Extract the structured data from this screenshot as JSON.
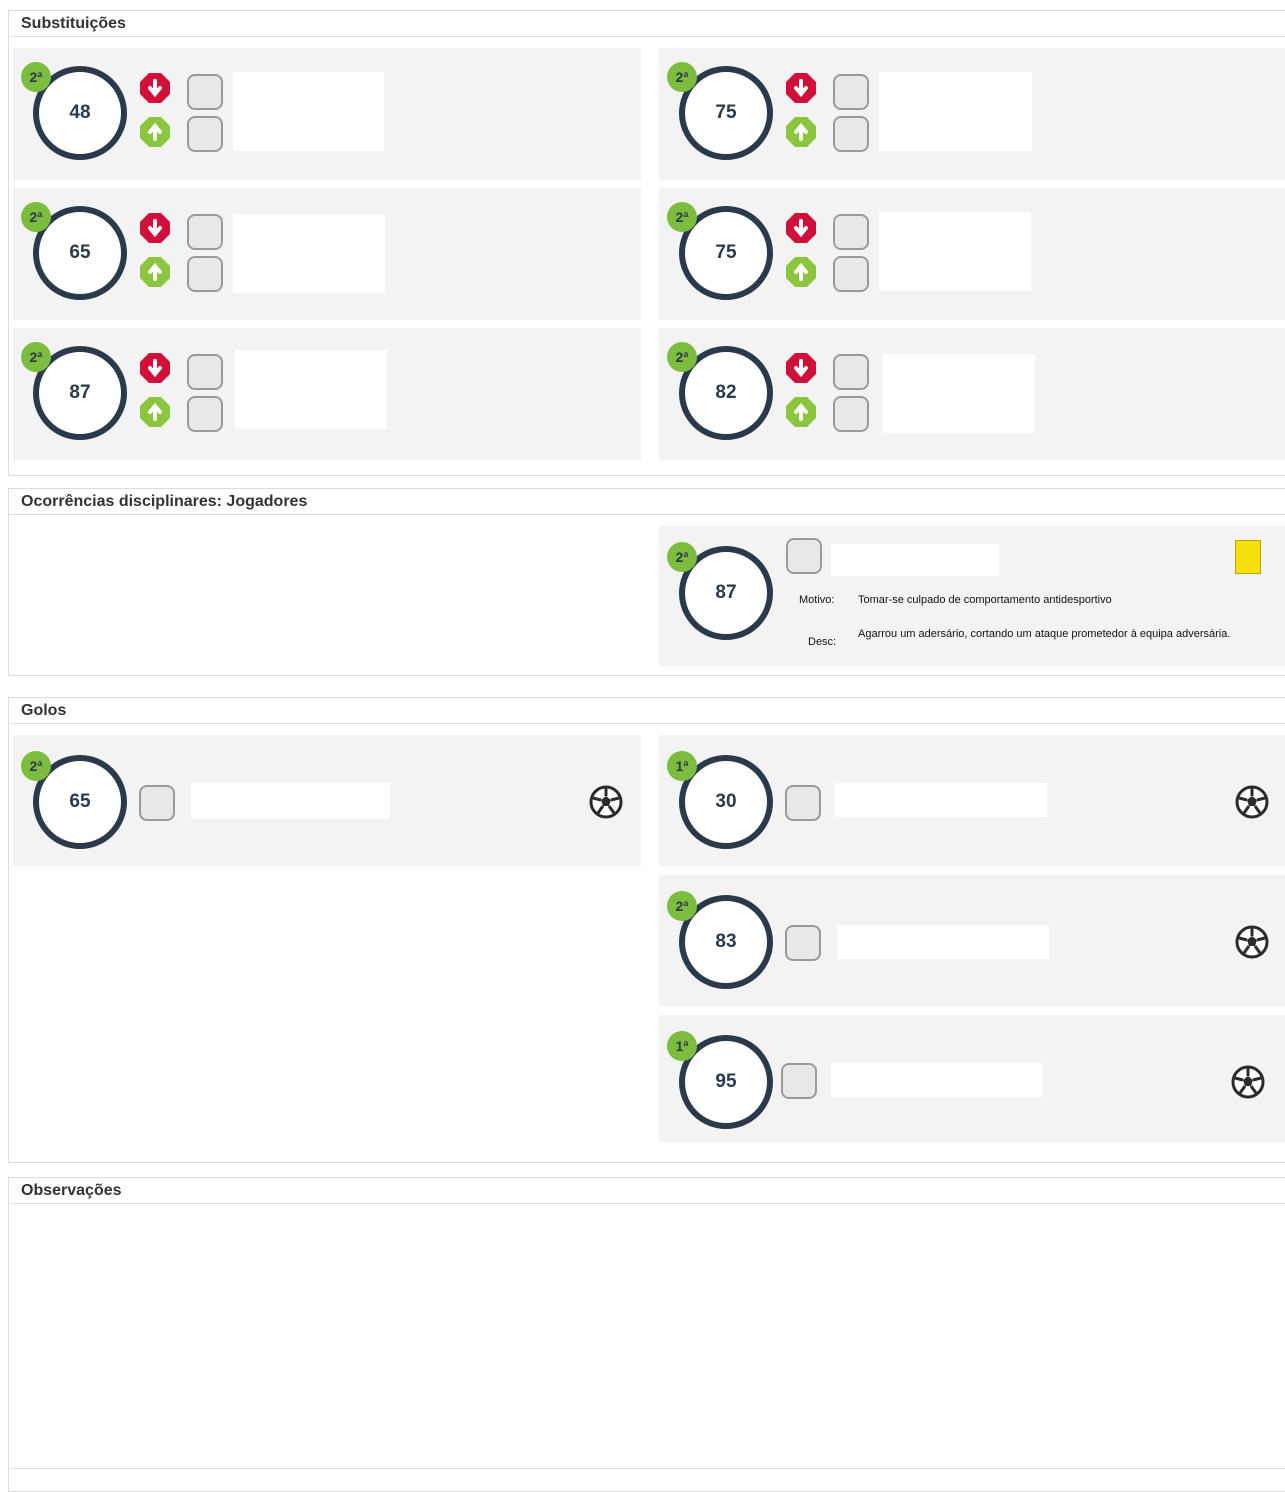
{
  "sections": {
    "substitutions_title": "Substituições",
    "discipline_title": "Ocorrências disciplinares: Jogadores",
    "goals_title": "Golos",
    "observations_title": "Observações"
  },
  "substitutions": [
    {
      "half": "2ª",
      "minute": "48"
    },
    {
      "half": "2ª",
      "minute": "75"
    },
    {
      "half": "2ª",
      "minute": "65"
    },
    {
      "half": "2ª",
      "minute": "75"
    },
    {
      "half": "2ª",
      "minute": "87"
    },
    {
      "half": "2ª",
      "minute": "82"
    }
  ],
  "discipline": [
    {
      "half": "2ª",
      "minute": "87",
      "card": "yellow",
      "motivo_label": "Motivo:",
      "motivo": "Tomar-se culpado de comportamento antidesportivo",
      "desc_label": "Desc:",
      "desc": "Agarrou um adersário, cortando um ataque prometedor à equipa adversária."
    }
  ],
  "goals": [
    {
      "half": "2ª",
      "minute": "65"
    },
    {
      "half": "1ª",
      "minute": "30"
    },
    {
      "half": "2ª",
      "minute": "83"
    },
    {
      "half": "1ª",
      "minute": "95"
    }
  ],
  "colors": {
    "ring": "#2b3a4a",
    "half_badge": "#7cbd3f",
    "sub_out": "#d0103a",
    "sub_in": "#8cc63f",
    "yellow_card": "#f6e10a",
    "card_bg": "#f3f3f3"
  },
  "icons": {
    "sub_out": "arrow-out-octagon-icon",
    "sub_in": "arrow-in-octagon-icon",
    "goal": "soccer-ball-icon",
    "player": "player-shirt-icon"
  }
}
